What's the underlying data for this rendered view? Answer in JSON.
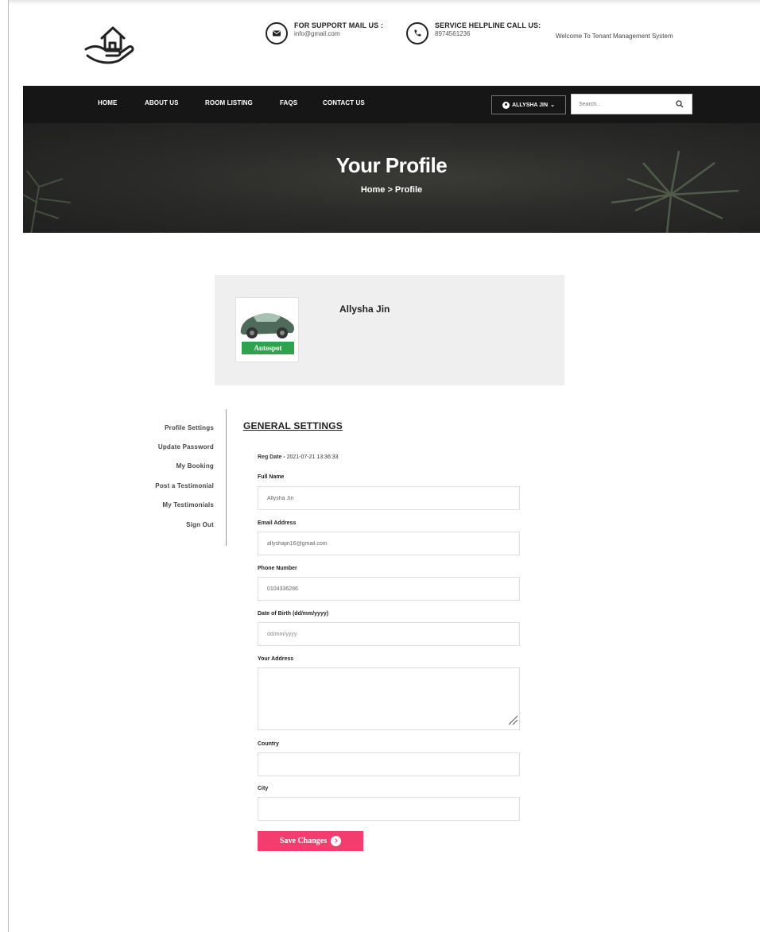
{
  "header": {
    "support_title": "FOR SUPPORT MAIL US :",
    "support_email": "info@gmail.com",
    "helpline_title": "SERVICE HELPLINE CALL US:",
    "helpline_phone": "8974561236",
    "welcome": "Welcome To Tenant Management System"
  },
  "nav": {
    "items": [
      "HOME",
      "ABOUT US",
      "ROOM LISTING",
      "FAQS",
      "CONTACT US"
    ],
    "user_label": "ALLYSHA JIN",
    "search_placeholder": "Search..."
  },
  "hero": {
    "title": "Your Profile",
    "breadcrumb": "Home > Profile"
  },
  "profile": {
    "name": "Allysha Jin",
    "avatar_badge": "Autospot"
  },
  "sidebar": {
    "items": [
      "Profile Settings",
      "Update Password",
      "My Booking",
      "Post a Testimonial",
      "My Testimonials",
      "Sign Out"
    ]
  },
  "form": {
    "section_title": "GENERAL SETTINGS",
    "reg_date_label": "Reg Date -",
    "reg_date_value": "2021-07-21 13:36:33",
    "full_name_label": "Full Name",
    "full_name_value": "Allysha Jin",
    "email_label": "Email Address",
    "email_value": "allyshajin16@gmail.com",
    "phone_label": "Phone Number",
    "phone_value": "0104336286",
    "dob_label": "Date of Birth (dd/mm/yyyy)",
    "dob_placeholder": "dd/mm/yyyy",
    "address_label": "Your Address",
    "country_label": "Country",
    "city_label": "City",
    "save_label": "Save Changes"
  },
  "colors": {
    "navbar": "#161616",
    "accent": "#f23d6e",
    "badge": "#2ea34d",
    "card": "#efefef"
  }
}
